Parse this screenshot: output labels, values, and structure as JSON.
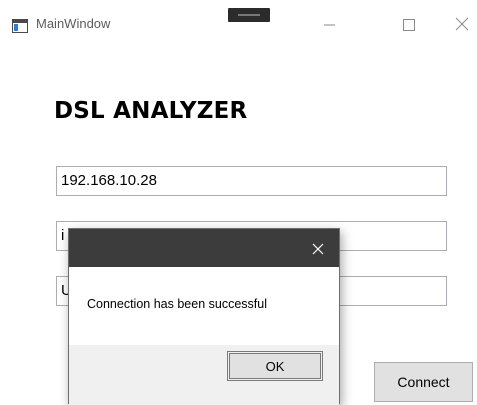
{
  "window": {
    "title": "MainWindow",
    "icon": "window-app-icon",
    "controls": {
      "minimize": "minimize-icon",
      "maximize": "maximize-icon",
      "close": "close-icon"
    }
  },
  "main": {
    "heading": "DSL ANALYZER",
    "fields": {
      "ip_value": "192.168.10.28",
      "user_value": "i",
      "pass_value": "U"
    },
    "connect_label": "Connect"
  },
  "dialog": {
    "message": "Connection has been successful",
    "ok_label": "OK",
    "close_icon": "close-icon"
  },
  "colors": {
    "dialog_titlebar": "#3c3c3c",
    "dialog_footer": "#f0f0f0",
    "button_face": "#e1e1e1",
    "field_border": "#abadb3"
  }
}
